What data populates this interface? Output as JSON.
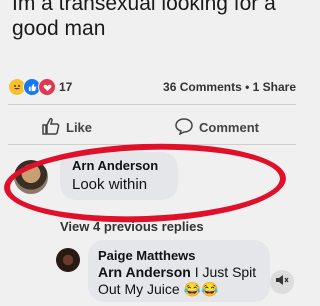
{
  "post": {
    "text": "Im a transexual looking for a good man"
  },
  "reactions": {
    "count": "17",
    "comments": "36 Comments",
    "separator": "•",
    "shares": "1 Share"
  },
  "actions": {
    "like_label": "Like",
    "comment_label": "Comment"
  },
  "comment": {
    "author": "Arn Anderson",
    "text": "Look within"
  },
  "replies": {
    "view_previous": "View 4 previous replies",
    "reply": {
      "author": "Paige Matthews",
      "mention": "Arn Anderson",
      "text": " I Just Spit Out My Juice",
      "emoji": "😂😂"
    }
  },
  "colors": {
    "annotation": "#e0102a",
    "bubble": "#e4e6ea",
    "like_blue": "#1877f2"
  }
}
